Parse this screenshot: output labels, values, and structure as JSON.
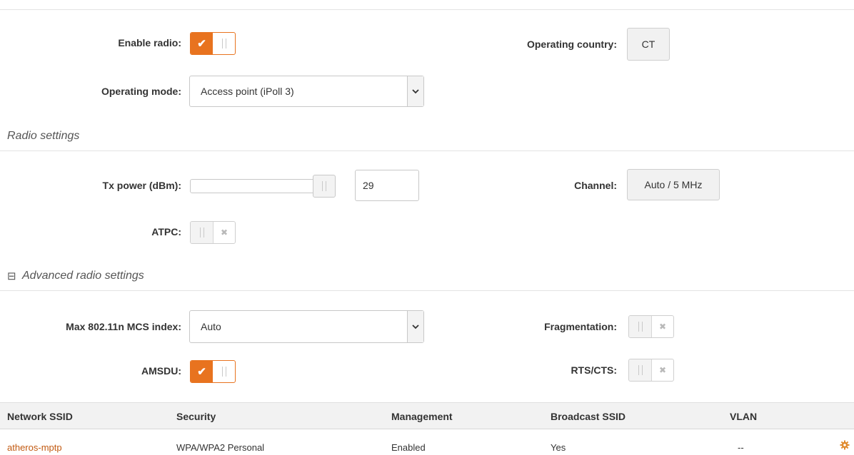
{
  "radio": {
    "enable_radio_label": "Enable radio:",
    "enable_radio_checked": true,
    "operating_country_label": "Operating country:",
    "operating_country_value": "CT",
    "operating_mode_label": "Operating mode:",
    "operating_mode_value": "Access point (iPoll 3)"
  },
  "radio_settings": {
    "title": "Radio settings",
    "tx_power_label": "Tx power (dBm):",
    "tx_power_value": "29",
    "tx_power_slider_level": 1.0,
    "channel_label": "Channel:",
    "channel_value": "Auto / 5 MHz",
    "atpc_label": "ATPC:",
    "atpc_checked": false
  },
  "advanced": {
    "toggle_glyph": "⊟",
    "title": "Advanced radio settings",
    "mcs_label": "Max 802.11n MCS index:",
    "mcs_value": "Auto",
    "fragmentation_label": "Fragmentation:",
    "fragmentation_checked": false,
    "amsdu_label": "AMSDU:",
    "amsdu_checked": true,
    "rts_label": "RTS/CTS:",
    "rts_checked": false
  },
  "table": {
    "headers": [
      "Network SSID",
      "Security",
      "Management",
      "Broadcast SSID",
      "VLAN"
    ],
    "rows": [
      {
        "ssid": "atheros-mptp",
        "security": "WPA/WPA2 Personal",
        "management": "Enabled",
        "broadcast": "Yes",
        "vlan": "--"
      }
    ]
  },
  "icons": {
    "check": "✔",
    "cross": "✖",
    "dropdown": "chevron-down-icon",
    "row_settings": "gear-icon"
  },
  "colors": {
    "accent": "#e8731f",
    "link": "#c25a12"
  }
}
